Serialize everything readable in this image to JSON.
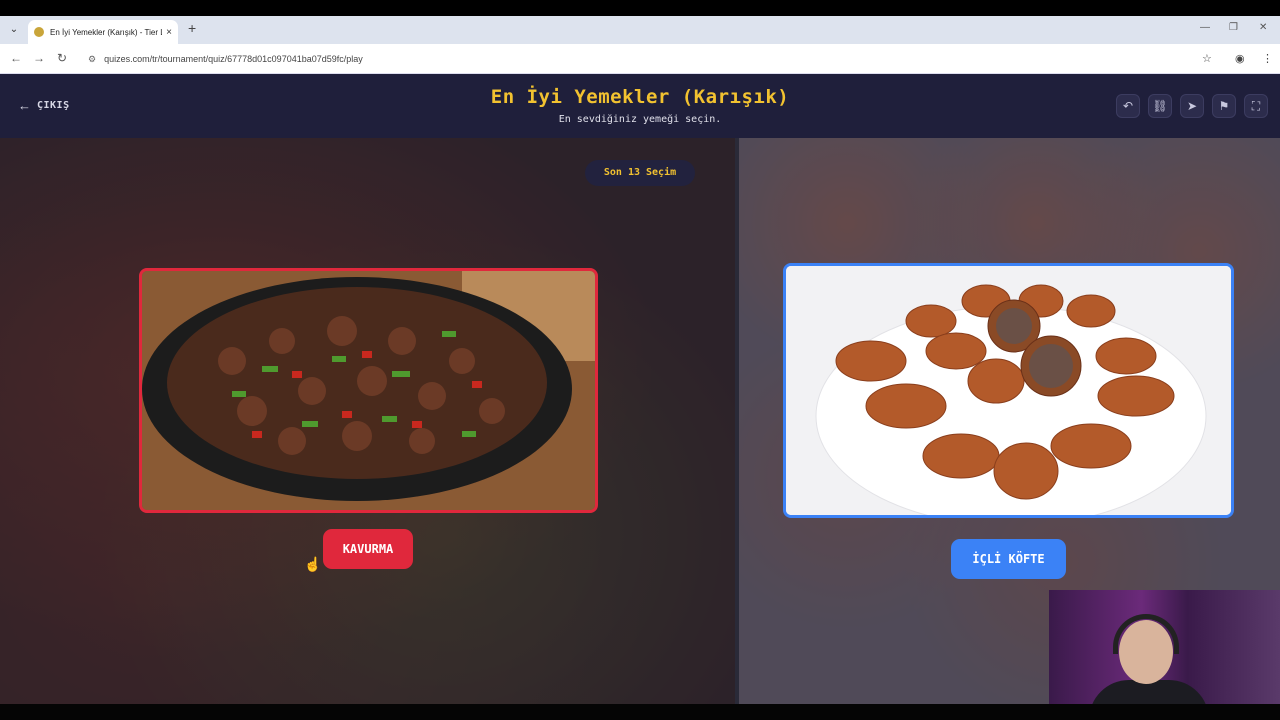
{
  "browser": {
    "tab_title": "En İyi Yemekler (Karışık) - Tier L",
    "new_tab": "+",
    "tab_close": "×",
    "url": "quizes.com/tr/tournament/quiz/67778d01c097041ba07d59fc/play"
  },
  "header": {
    "exit_label": "ÇIKIŞ",
    "title": "En İyi Yemekler (Karışık)",
    "subtitle": "En sevdiğiniz yemeği seçin."
  },
  "stage": {
    "round_label": "Son 13 Seçim",
    "left": {
      "name": "KAVURMA",
      "accent": "#e0283c"
    },
    "right": {
      "name": "İÇLİ KÖFTE",
      "accent": "#3b82f6"
    }
  },
  "colors": {
    "header_bg": "#1f1f3b",
    "title": "#f2c230"
  },
  "icons": {
    "tools": [
      "undo-icon",
      "share-link-icon",
      "send-icon",
      "flag-icon",
      "fullscreen-icon"
    ]
  }
}
